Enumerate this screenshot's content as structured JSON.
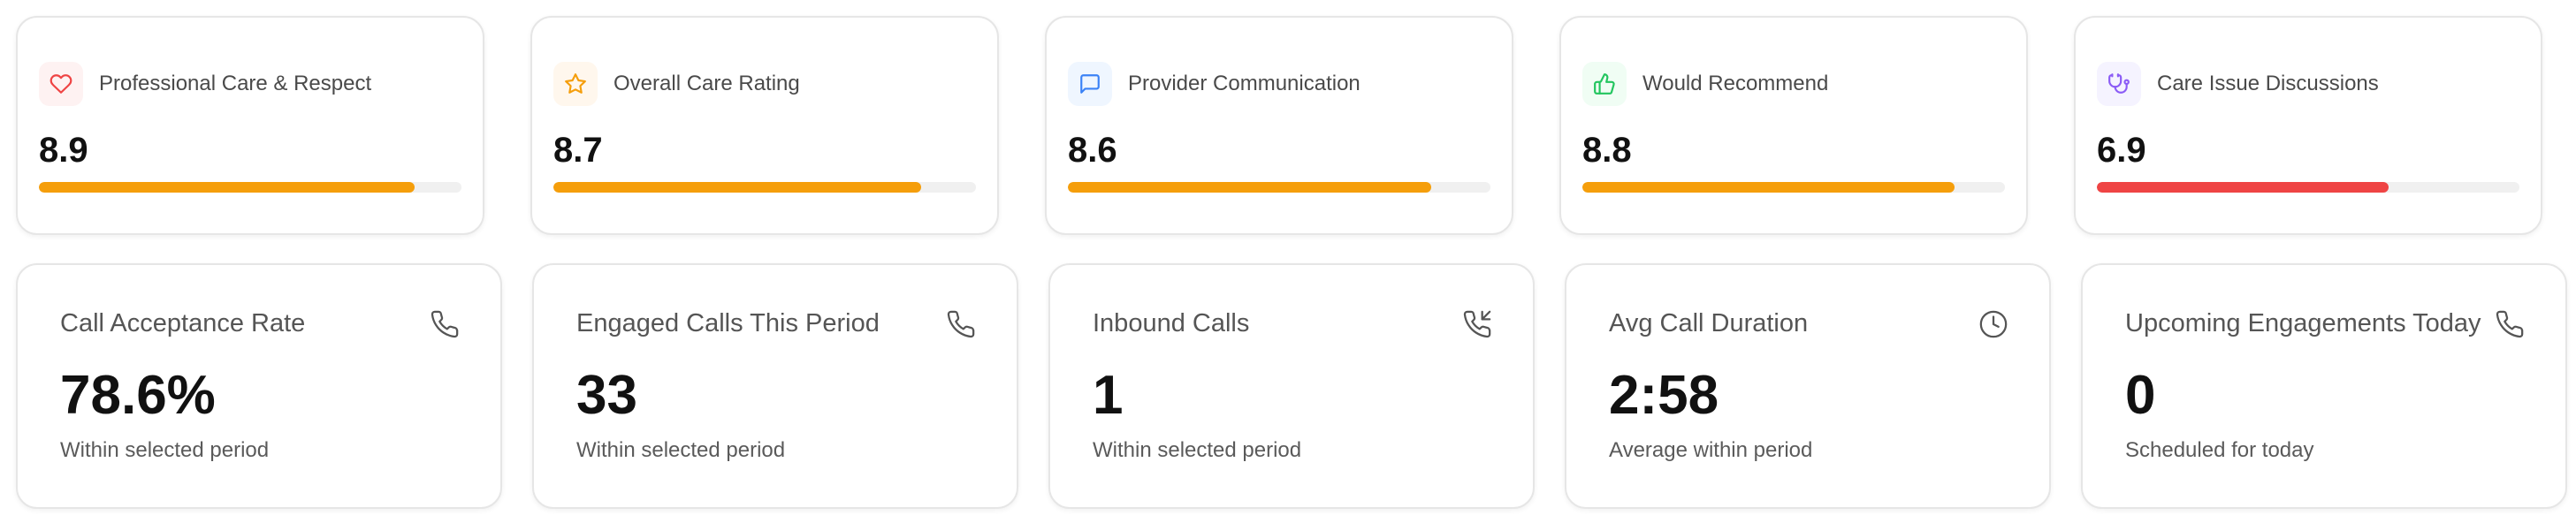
{
  "rating_cards": [
    {
      "label": "Professional Care & Respect",
      "value": "8.9",
      "fill_fraction": 0.89,
      "icon": "heart-icon",
      "bar_color": "#F59E0B",
      "icon_color": "#EF4444",
      "icon_bg": "#FEF2F2"
    },
    {
      "label": "Overall Care Rating",
      "value": "8.7",
      "fill_fraction": 0.87,
      "icon": "star-icon",
      "bar_color": "#F59E0B",
      "icon_color": "#F59E0B",
      "icon_bg": "#FFF7ED"
    },
    {
      "label": "Provider Communication",
      "value": "8.6",
      "fill_fraction": 0.86,
      "icon": "message-icon",
      "bar_color": "#F59E0B",
      "icon_color": "#3B82F6",
      "icon_bg": "#EFF6FF"
    },
    {
      "label": "Would Recommend",
      "value": "8.8",
      "fill_fraction": 0.88,
      "icon": "thumbs-up-icon",
      "bar_color": "#F59E0B",
      "icon_color": "#22C55E",
      "icon_bg": "#F0FDF4"
    },
    {
      "label": "Care Issue Discussions",
      "value": "6.9",
      "fill_fraction": 0.69,
      "icon": "stethoscope-icon",
      "bar_color": "#EF4444",
      "icon_color": "#8B5CF6",
      "icon_bg": "#F5F3FF"
    }
  ],
  "stat_cards": [
    {
      "label": "Call Acceptance Rate",
      "value": "78.6%",
      "sub": "Within selected period",
      "icon": "phone-icon"
    },
    {
      "label": "Engaged Calls This Period",
      "value": "33",
      "sub": "Within selected period",
      "icon": "phone-icon"
    },
    {
      "label": "Inbound Calls",
      "value": "1",
      "sub": "Within selected period",
      "icon": "phone-incoming-icon"
    },
    {
      "label": "Avg Call Duration",
      "value": "2:58",
      "sub": "Average within period",
      "icon": "clock-icon"
    },
    {
      "label": "Upcoming Engagements Today",
      "value": "0",
      "sub": "Scheduled for today",
      "icon": "phone-icon"
    }
  ]
}
